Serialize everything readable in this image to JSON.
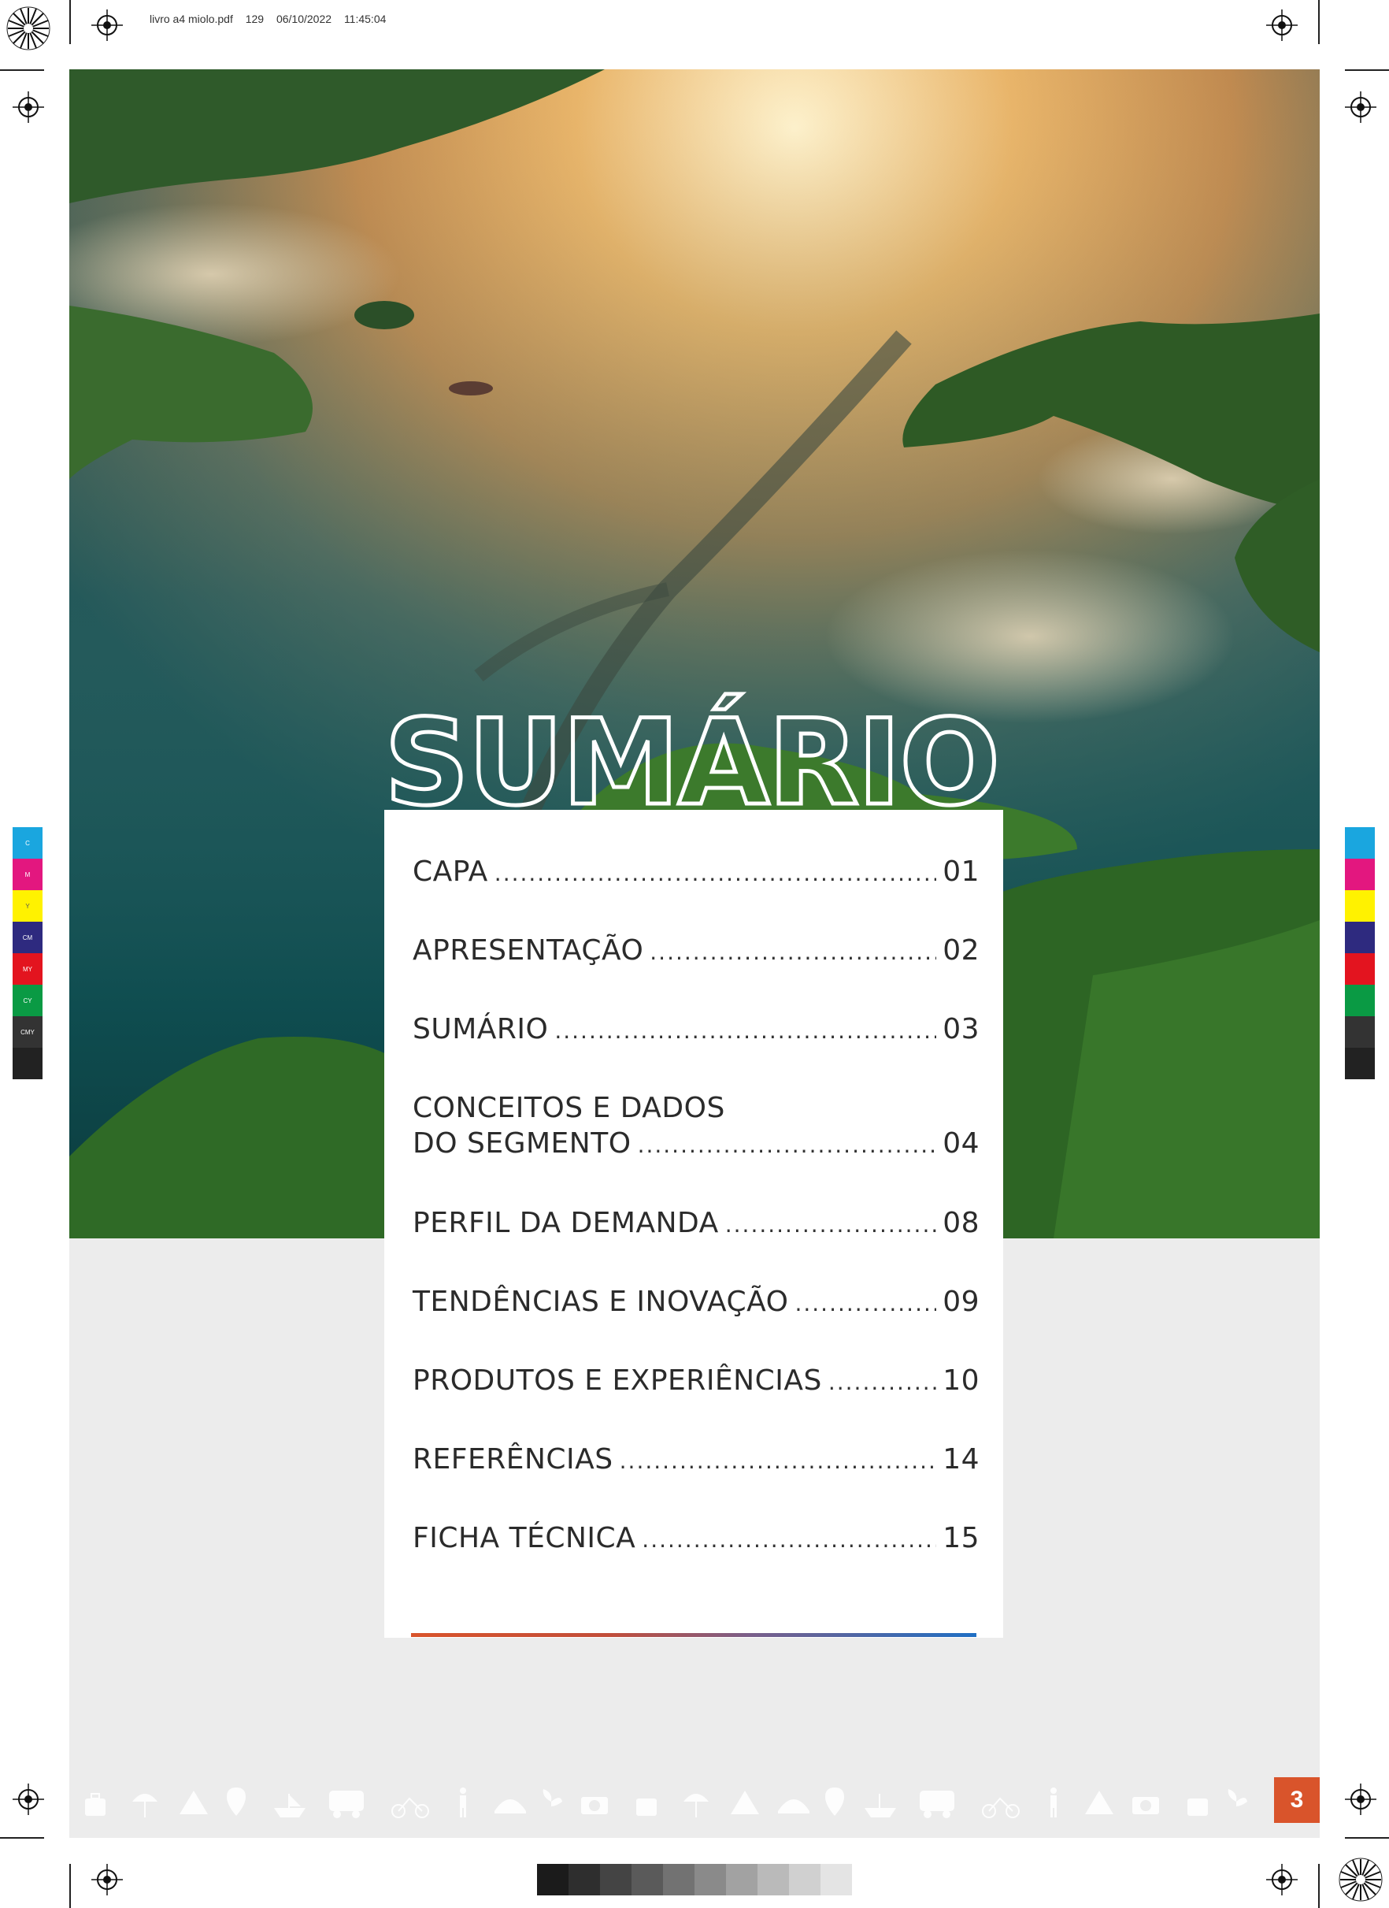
{
  "slug": {
    "file": "livro a4 miolo.pdf",
    "page": "129",
    "date": "06/10/2022",
    "time": "11:45:04"
  },
  "title": "SUMÁRIO",
  "toc": [
    {
      "label": "CAPA",
      "page": "01"
    },
    {
      "label": "APRESENTAÇÃO",
      "page": "02"
    },
    {
      "label": "SUMÁRIO",
      "page": "03"
    },
    {
      "label_line1": "CONCEITOS E DADOS",
      "label": "DO SEGMENTO",
      "page": "04"
    },
    {
      "label": "PERFIL DA DEMANDA",
      "page": "08"
    },
    {
      "label": "TENDÊNCIAS E INOVAÇÃO",
      "page": "09"
    },
    {
      "label": "PRODUTOS E EXPERIÊNCIAS",
      "page": "10"
    },
    {
      "label": "REFERÊNCIAS",
      "page": "14"
    },
    {
      "label": "FICHA TÉCNICA",
      "page": "15"
    }
  ],
  "page_number": "3",
  "color_bar_labels": [
    "C",
    "M",
    "Y",
    "CM",
    "MY",
    "CY",
    "CMY"
  ],
  "colors": {
    "accent_orange": "#d9542b",
    "accent_blue": "#1f6fc4",
    "band_grey": "#ececec"
  },
  "icons": [
    "suitcase-icon",
    "umbrella-icon",
    "tent-icon",
    "location-pin-icon",
    "boat-icon",
    "cyclist-icon",
    "bus-icon",
    "hiker-icon",
    "cloche-icon",
    "plant-icon",
    "camera-icon"
  ]
}
